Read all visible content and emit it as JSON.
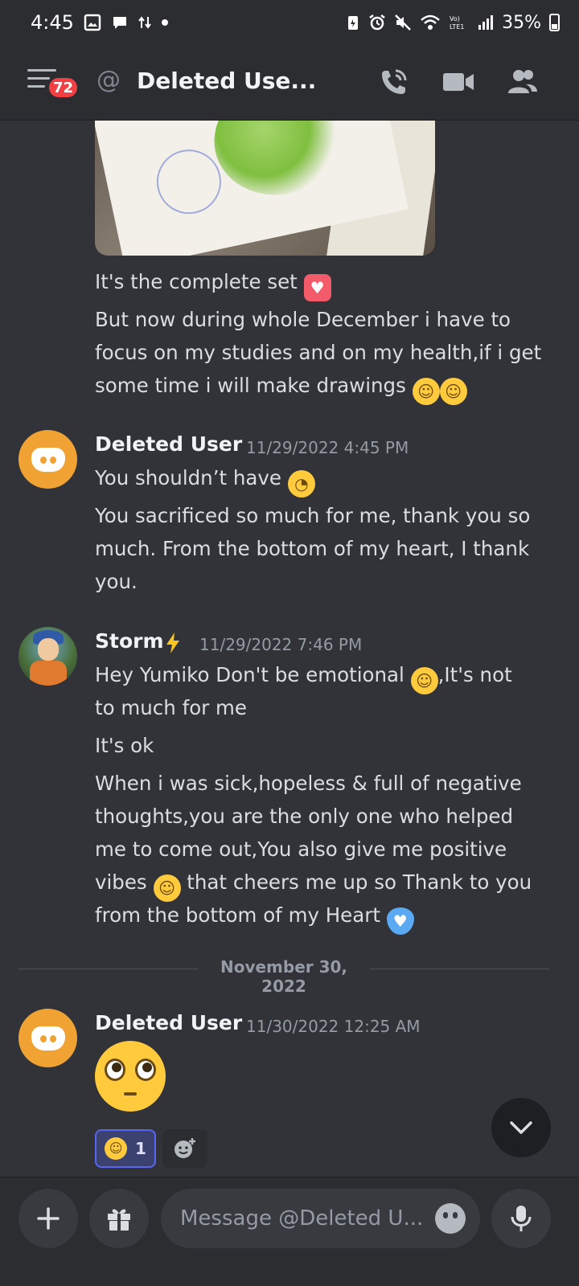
{
  "status_bar": {
    "time": "4:45",
    "battery": "35%"
  },
  "header": {
    "unread_badge": "72",
    "at_symbol": "@",
    "title": "Deleted Use..."
  },
  "messages": {
    "continuation_lines": [
      "It's the complete set",
      "But now during whole December i have to",
      "focus on my studies and on my health,if i get",
      "some time i will make drawings"
    ],
    "groups": [
      {
        "author": "Deleted User",
        "timestamp": "11/29/2022 4:45 PM",
        "lines": [
          "You shouldn’t have",
          "You sacrificed so much for me, thank you so",
          "much. From the bottom of my heart, I thank",
          "you."
        ]
      },
      {
        "author": "Storm",
        "author_icon": "lightning-icon",
        "timestamp": "11/29/2022 7:46 PM",
        "lines": [
          "Hey Yumiko Don't be emotional",
          ",It's not",
          "to much for me",
          "It's ok",
          "When i was sick,hopeless & full of negative",
          "thoughts,you are the only one who helped",
          "me to come out,You also give me positive",
          "vibes",
          " that cheers me up so Thank to you",
          "from the bottom of my Heart"
        ]
      },
      {
        "author": "Deleted User",
        "timestamp": "11/30/2022 12:25 AM",
        "reaction_count": "1"
      }
    ],
    "date_divider": "November 30, 2022"
  },
  "composer": {
    "placeholder": "Message @Deleted U..."
  },
  "colors": {
    "background": "#313338",
    "panel": "#2b2d31",
    "accent": "#5865f2",
    "avatar_orange": "#f0a232",
    "badge_red": "#f23f43"
  }
}
